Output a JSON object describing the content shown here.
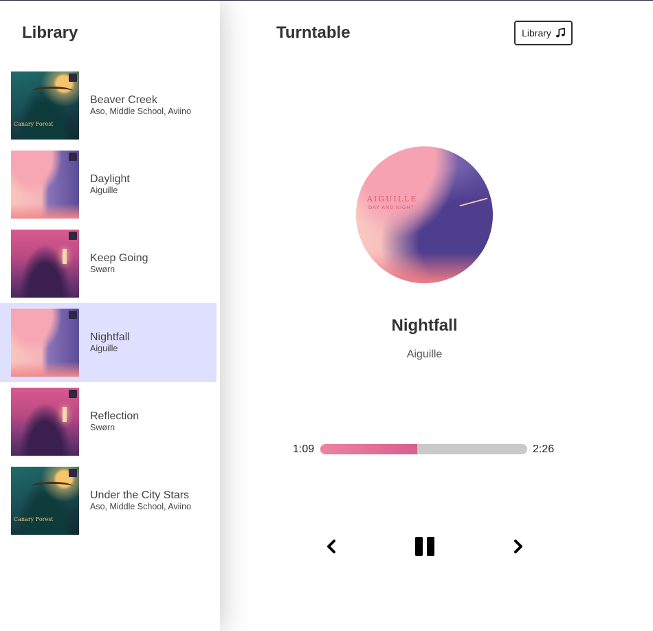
{
  "library": {
    "title": "Library",
    "songs": [
      {
        "title": "Beaver Creek",
        "artist": "Aso, Middle School, Aviino",
        "cover_caption": "Canary Forest"
      },
      {
        "title": "Daylight",
        "artist": "Aiguille"
      },
      {
        "title": "Keep Going",
        "artist": "Swørn"
      },
      {
        "title": "Nightfall",
        "artist": "Aiguille",
        "selected": true
      },
      {
        "title": "Reflection",
        "artist": "Swørn"
      },
      {
        "title": "Under the City Stars",
        "artist": "Aso, Middle School, Aviino",
        "cover_caption": "Canary Forest"
      }
    ]
  },
  "header": {
    "title": "Turntable",
    "library_button_label": "Library",
    "library_button_icon": "music-note-icon"
  },
  "player": {
    "album_art_text": "AIGUILLE",
    "album_art_subtext": "DAY AND NIGHT",
    "track_title": "Nightfall",
    "track_artist": "Aiguille",
    "current_time": "1:09",
    "total_time": "2:26",
    "progress": 0.47,
    "controls": [
      "chevron-left-icon",
      "pause-icon",
      "chevron-right-icon"
    ]
  },
  "colors": {
    "selected_bg": "#dfe0ff",
    "progress_start": "#ec83a2",
    "progress_end": "#d95f8e",
    "track_bg": "#c9c9c9"
  }
}
